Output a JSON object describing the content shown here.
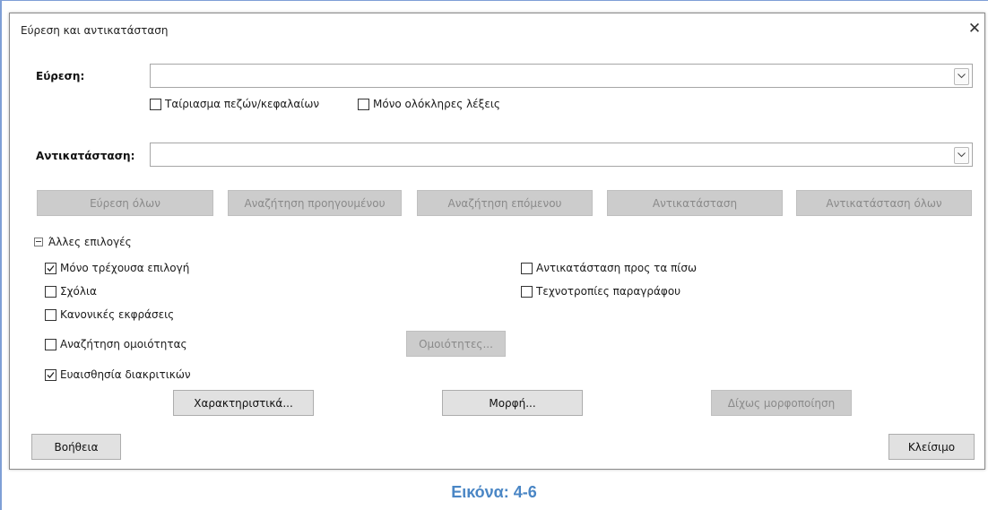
{
  "window": {
    "title": "Εύρεση και αντικατάσταση",
    "close_glyph": "✕"
  },
  "find": {
    "label": "Εύρεση:",
    "value": "",
    "match_case": {
      "label": "Ταίριασμα πεζών/κεφαλαίων",
      "checked": false
    },
    "whole_words": {
      "label": "Μόνο ολόκληρες λέξεις",
      "checked": false
    }
  },
  "replace": {
    "label": "Αντικατάσταση:",
    "value": ""
  },
  "actions": {
    "find_all": "Εύρεση όλων",
    "find_previous": "Αναζήτηση προηγουμένου",
    "find_next": "Αναζήτηση επόμενου",
    "replace": "Αντικατάσταση",
    "replace_all": "Αντικατάσταση όλων"
  },
  "other_options": {
    "header": "Άλλες επιλογές",
    "current_selection_only": {
      "label": "Μόνο τρέχουσα επιλογή",
      "checked": true
    },
    "comments": {
      "label": "Σχόλια",
      "checked": false
    },
    "regular_expressions": {
      "label": "Κανονικές εκφράσεις",
      "checked": false
    },
    "similarity_search": {
      "label": "Αναζήτηση ομοιότητας",
      "checked": false
    },
    "similarities_button": "Ομοιότητες...",
    "diacritics_sensitive": {
      "label": "Ευαισθησία διακριτικών",
      "checked": true
    },
    "replace_backwards": {
      "label": "Αντικατάσταση προς τα πίσω",
      "checked": false
    },
    "paragraph_styles": {
      "label": "Τεχνοτροπίες παραγράφου",
      "checked": false
    },
    "attributes_button": "Χαρακτηριστικά...",
    "format_button": "Μορφή...",
    "no_format_button": "Δίχως μορφοποίηση"
  },
  "footer": {
    "help": "Βοήθεια",
    "close": "Κλείσιμο"
  },
  "caption": "Εικόνα: 4-6"
}
